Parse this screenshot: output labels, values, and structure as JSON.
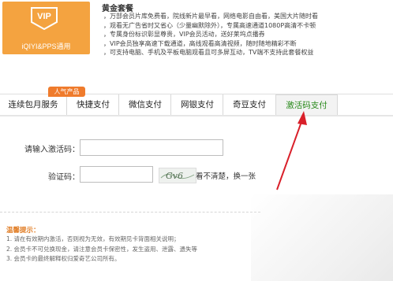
{
  "vip_card": {
    "badge_text": "VIP",
    "subtitle": "iQIYI&PPS通用"
  },
  "package": {
    "title": "黄金套餐",
    "features": [
      "，万部会员片库免费看，院线新片最早看，网络电影自由看，美国大片随时看",
      "，观看无广告省时又省心（少量幽默除外），专属高速通道1080P高清不卡顿",
      "，专属身份标识彰显尊贵，VIP会员活动，送好莱坞点播券",
      "，VIP会员独享高速下载通道，高线观看高清视频，随时随地精彩不断",
      "，可支持电脑、手机及平板电脑观看且可多屏互动，TV端不支持此套餐权益"
    ]
  },
  "tabs": {
    "hot_badge": "人气产品",
    "items": [
      "连续包月服务",
      "快捷支付",
      "微信支付",
      "网银支付",
      "奇豆支付",
      "激活码支付"
    ]
  },
  "form": {
    "code_label": "请输入激活码：",
    "code_value": "",
    "captcha_label": "验证码：",
    "captcha_value": "",
    "captcha_image_text": "Gv6",
    "refresh_text": "看不清楚，换一张"
  },
  "tips": {
    "title": "温馨提示：",
    "items": [
      "1. 请在有效期内激活，否则视为无效，有效期见卡背面相关说明；",
      "2. 会员卡不可兑换现金，请注意会员卡保密性，发生盗用、泄露、遗失等",
      "3. 会员卡的最终解释权归爱奇艺公司所有。"
    ]
  },
  "colors": {
    "vip_orange": "#f4a340",
    "active_tab_text": "#2a8a1c",
    "hot_badge": "#ef7b2c",
    "arrow": "#d9202a"
  }
}
